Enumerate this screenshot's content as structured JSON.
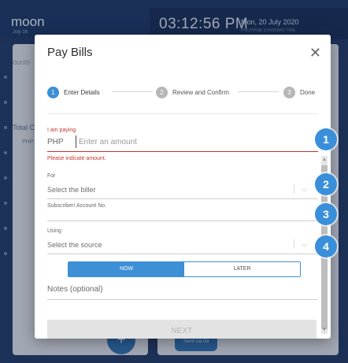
{
  "background": {
    "left_title": "moon",
    "left_subtitle": "July 16",
    "accounts_label": "ounts",
    "total_label": "Total C",
    "php_label": "PHP",
    "clock": "03:12:56 PM",
    "date": "Mon, 20 July 2020",
    "timezone": "PHILIPPINE STANDARD TIME",
    "fab_label": "+",
    "send_label": "Send via Gil"
  },
  "modal": {
    "title": "Pay Bills",
    "close_icon": "close-icon",
    "steps": [
      {
        "num": "1",
        "label": "Enter Details",
        "state": "active"
      },
      {
        "num": "2",
        "label": "Review and Confirm",
        "state": "pending"
      },
      {
        "num": "3",
        "label": "Done",
        "state": "pending"
      }
    ],
    "paying_label": "I am paying",
    "currency": "PHP",
    "amount_placeholder": "Enter an amount",
    "amount_error": "Please indicate amount.",
    "for_label": "For",
    "biller_placeholder": "Select the biller",
    "account_label": "Subscriber/ Account No.",
    "using_label": "Using",
    "source_placeholder": "Select the source",
    "toggle_now": "NOW",
    "toggle_later": "LATER",
    "notes_placeholder": "Notes (optional)",
    "next_label": "NEXT",
    "accent_color": "#3d8fd6",
    "error_color": "#c0392b"
  },
  "badges": [
    "1",
    "2",
    "3",
    "4"
  ]
}
